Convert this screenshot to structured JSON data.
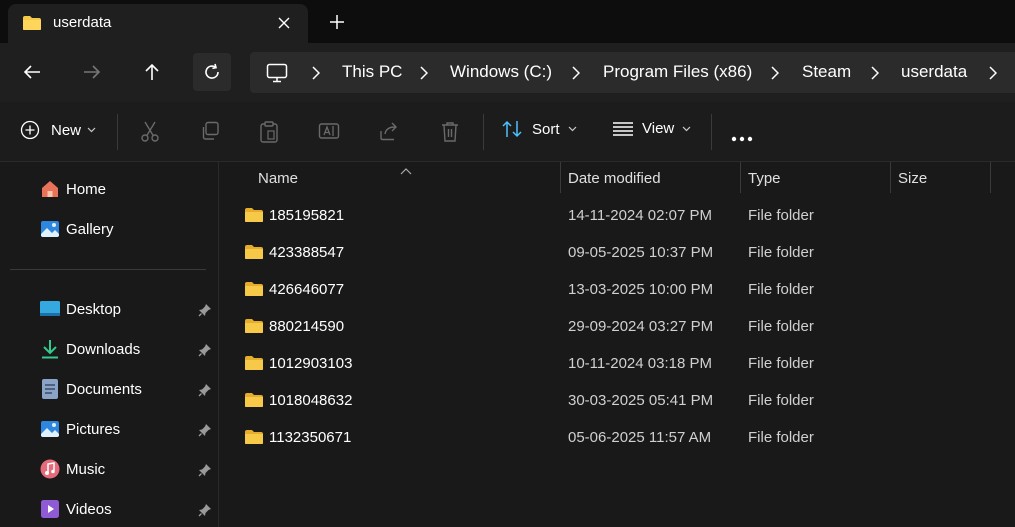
{
  "window": {
    "tab_title": "userdata",
    "new_tab_symbol": "+"
  },
  "address": {
    "crumbs": [
      "This PC",
      "Windows (C:)",
      "Program Files (x86)",
      "Steam",
      "userdata"
    ]
  },
  "commands": {
    "new_label": "New",
    "sort_label": "Sort",
    "view_label": "View"
  },
  "sidebar": {
    "top_items": [
      {
        "label": "Home",
        "icon": "home-icon"
      },
      {
        "label": "Gallery",
        "icon": "gallery-icon"
      }
    ],
    "pinned_items": [
      {
        "label": "Desktop",
        "icon": "desktop-icon"
      },
      {
        "label": "Downloads",
        "icon": "downloads-icon"
      },
      {
        "label": "Documents",
        "icon": "documents-icon"
      },
      {
        "label": "Pictures",
        "icon": "pictures-icon"
      },
      {
        "label": "Music",
        "icon": "music-icon"
      },
      {
        "label": "Videos",
        "icon": "videos-icon"
      }
    ]
  },
  "columns": {
    "name": "Name",
    "date": "Date modified",
    "type": "Type",
    "size": "Size"
  },
  "files": [
    {
      "name": "185195821",
      "date": "14-11-2024 02:07 PM",
      "type": "File folder",
      "size": ""
    },
    {
      "name": "423388547",
      "date": "09-05-2025 10:37 PM",
      "type": "File folder",
      "size": ""
    },
    {
      "name": "426646077",
      "date": "13-03-2025 10:00 PM",
      "type": "File folder",
      "size": ""
    },
    {
      "name": "880214590",
      "date": "29-09-2024 03:27 PM",
      "type": "File folder",
      "size": ""
    },
    {
      "name": "1012903103",
      "date": "10-11-2024 03:18 PM",
      "type": "File folder",
      "size": ""
    },
    {
      "name": "1018048632",
      "date": "30-03-2025 05:41 PM",
      "type": "File folder",
      "size": ""
    },
    {
      "name": "1132350671",
      "date": "05-06-2025 11:57 AM",
      "type": "File folder",
      "size": ""
    }
  ],
  "colors": {
    "folder": "#f7c948",
    "accent": "#4cc2ff"
  }
}
